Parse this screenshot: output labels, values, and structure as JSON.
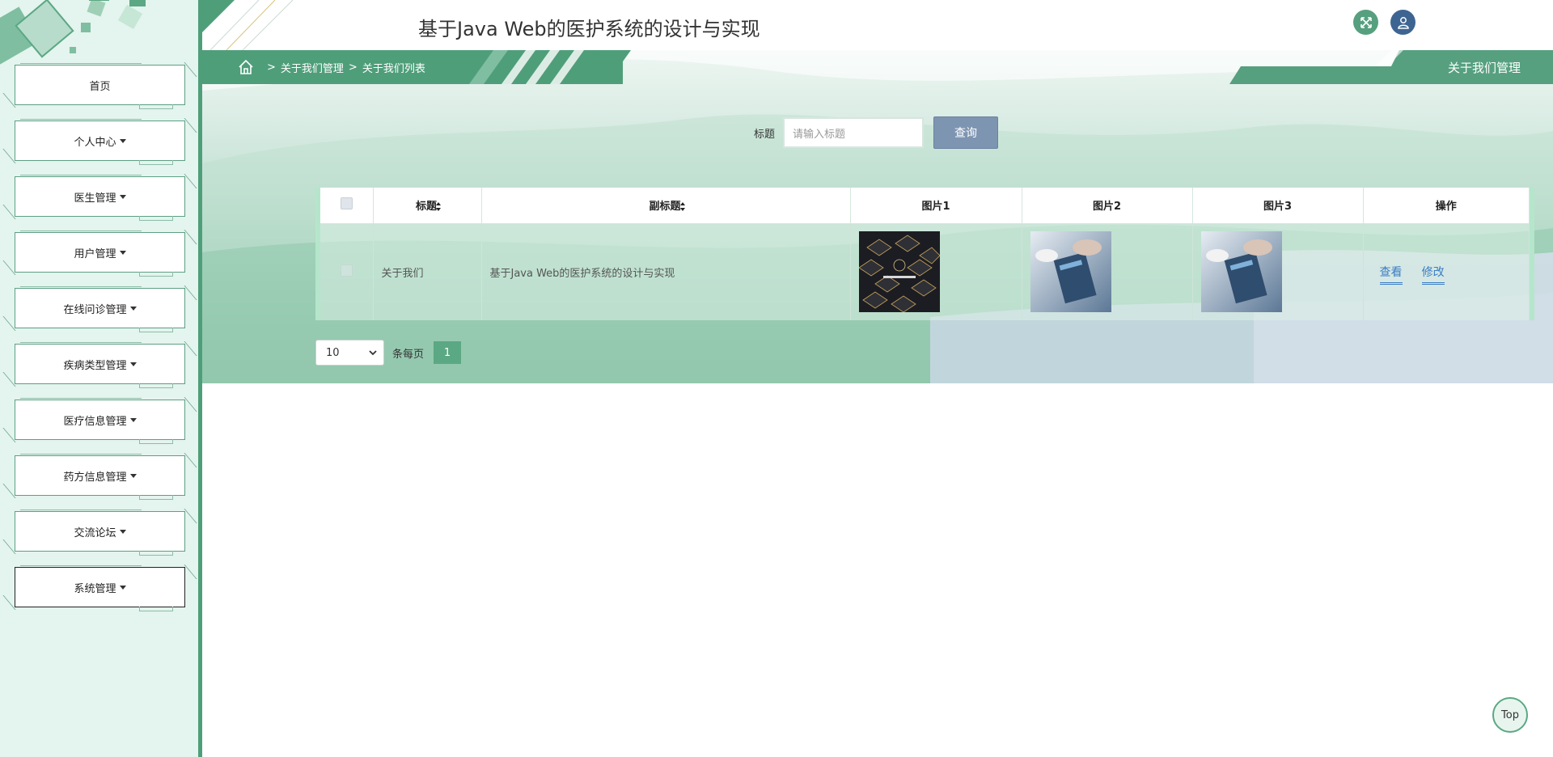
{
  "app": {
    "title": "基于Java Web的医护系统的设计与实现"
  },
  "sidebar": {
    "items": [
      {
        "label": "首页",
        "dropdown": false
      },
      {
        "label": "个人中心",
        "dropdown": true
      },
      {
        "label": "医生管理",
        "dropdown": true
      },
      {
        "label": "用户管理",
        "dropdown": true
      },
      {
        "label": "在线问诊管理",
        "dropdown": true
      },
      {
        "label": "疾病类型管理",
        "dropdown": true
      },
      {
        "label": "医疗信息管理",
        "dropdown": true
      },
      {
        "label": "药方信息管理",
        "dropdown": true
      },
      {
        "label": "交流论坛",
        "dropdown": true
      },
      {
        "label": "系统管理",
        "dropdown": true
      }
    ]
  },
  "breadcrumb": {
    "sep": ">",
    "level1": "关于我们管理",
    "level2": "关于我们列表"
  },
  "page_tag": "关于我们管理",
  "search": {
    "label": "标题",
    "placeholder": "请输入标题",
    "button": "查询"
  },
  "table": {
    "headers": {
      "title": "标题",
      "subtitle": "副标题",
      "img1": "图片1",
      "img2": "图片2",
      "img3": "图片3",
      "ops": "操作"
    },
    "rows": [
      {
        "title": "关于我们",
        "subtitle": "基于Java Web的医护系统的设计与实现",
        "view": "查看",
        "edit": "修改"
      }
    ]
  },
  "pager": {
    "page_size": "10",
    "per_page_label": "条每页",
    "current_page": "1"
  },
  "top_button": "Top",
  "colors": {
    "primary": "#4f9e7a",
    "sidebar_bg": "#e4f4ee",
    "query_button": "#7e95b2",
    "user_button": "#3e6592"
  },
  "icons": {
    "fullscreen": "fullscreen-icon",
    "user": "user-icon",
    "home": "home-icon"
  }
}
